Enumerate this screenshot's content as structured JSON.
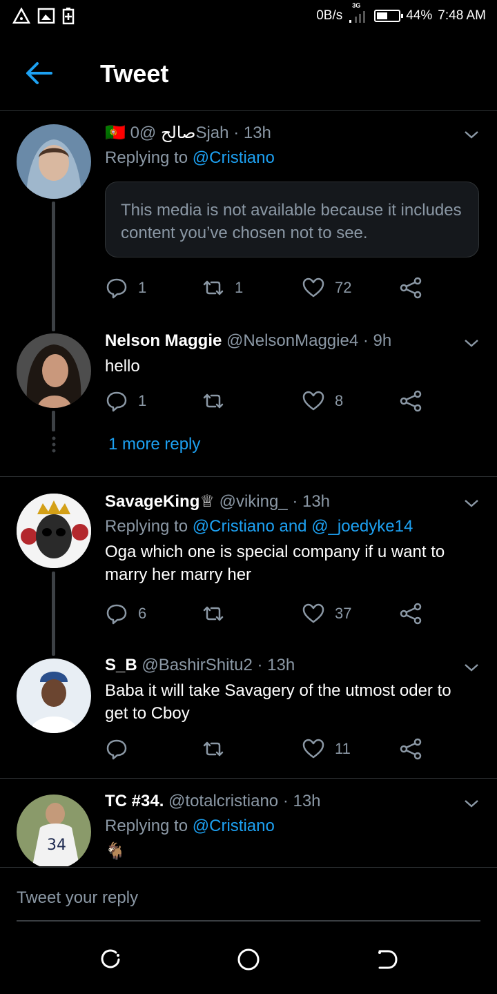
{
  "status_bar": {
    "net_speed": "0B/s",
    "network": "3G",
    "battery_percent_label": "44%",
    "time": "7:48 AM"
  },
  "header": {
    "title": "Tweet"
  },
  "tweets": [
    {
      "name": "صالح",
      "flag": "🇵🇹",
      "handle": "@0Sjah",
      "time": "· 13h",
      "replying_prefix": "Replying to",
      "replying_to": "@Cristiano",
      "media_notice": "This media is not available because it includes content you’ve chosen not to see.",
      "replies": "1",
      "retweets": "1",
      "likes": "72"
    },
    {
      "name": "Nelson Maggie",
      "handle": "@NelsonMaggie4",
      "time": "· 9h",
      "text": "hello",
      "replies": "1",
      "retweets": "",
      "likes": "8",
      "more_replies": "1 more reply"
    },
    {
      "name": "SavageKing♕",
      "handle": "@viking_",
      "time": "· 13h",
      "replying_prefix": "Replying to",
      "replying_to": "@Cristiano and @_joedyke14",
      "text": "Oga which one is special company if u want to marry her marry her",
      "replies": "6",
      "retweets": "",
      "likes": "37"
    },
    {
      "name": "S_B",
      "handle": "@BashirShitu2",
      "time": "· 13h",
      "text": "Baba it will take Savagery of the utmost oder to get to Cboy",
      "replies": "",
      "retweets": "",
      "likes": "11"
    },
    {
      "name": "TC #34.",
      "handle": "@totalcristiano",
      "time": "· 13h",
      "replying_prefix": "Replying to",
      "replying_to": "@Cristiano",
      "text": "🐐",
      "avatar_text": "34"
    }
  ],
  "reply_box": {
    "placeholder": "Tweet your reply"
  },
  "colors": {
    "accent": "#1da1f2",
    "muted": "#8b98a5",
    "divider": "#2f3336"
  }
}
